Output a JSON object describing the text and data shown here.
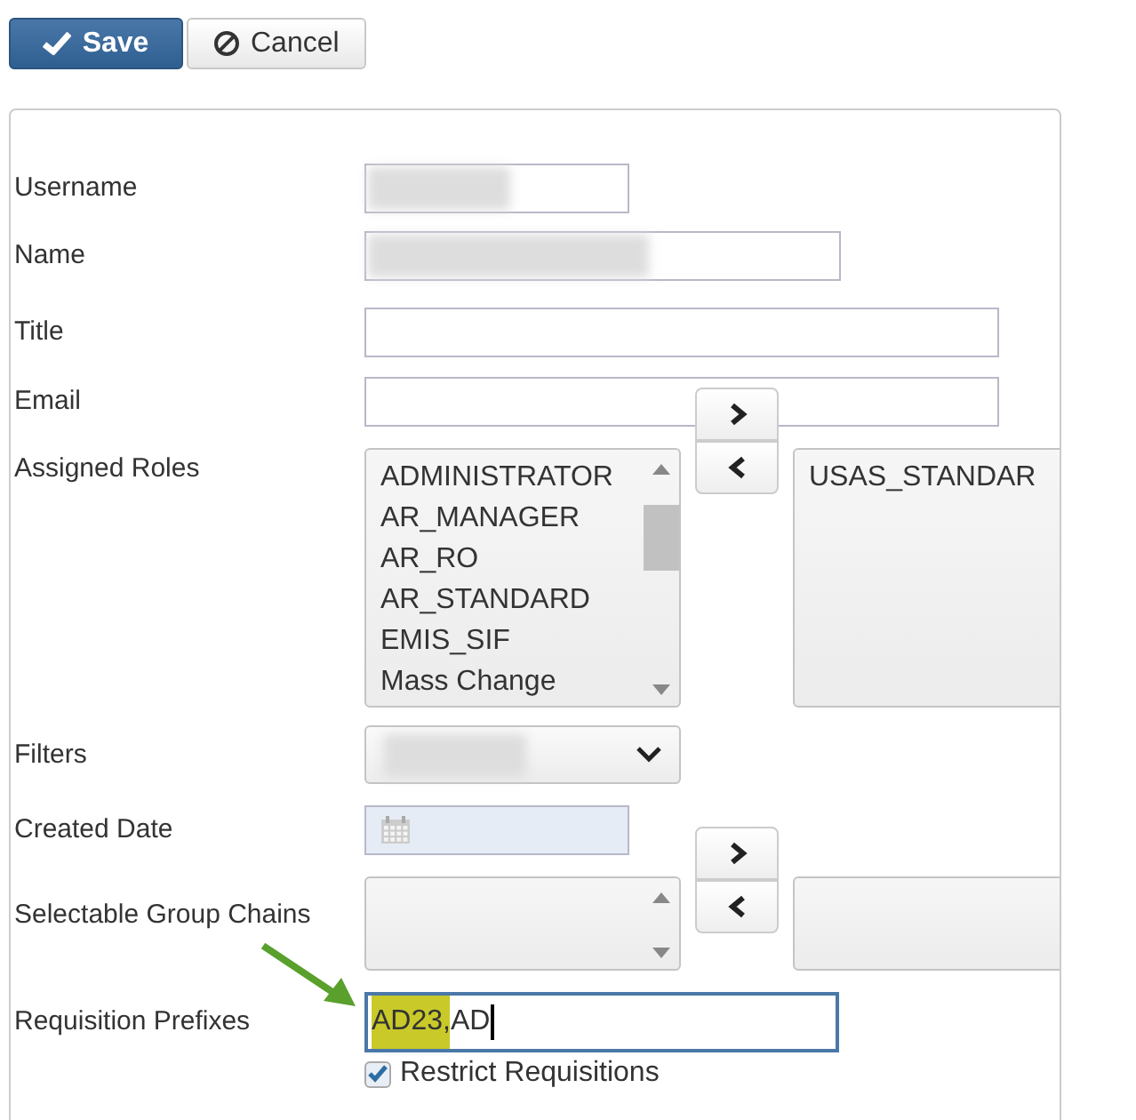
{
  "toolbar": {
    "save": {
      "label": "Save"
    },
    "cancel": {
      "label": "Cancel"
    }
  },
  "form": {
    "username": {
      "label": "Username"
    },
    "name": {
      "label": "Name"
    },
    "title": {
      "label": "Title"
    },
    "email": {
      "label": "Email"
    },
    "assigned_roles": {
      "label": "Assigned Roles",
      "available": [
        "ADMINISTRATOR",
        "AR_MANAGER",
        "AR_RO",
        "AR_STANDARD",
        "EMIS_SIF",
        "Mass Change"
      ],
      "assigned": [
        "USAS_STANDAR"
      ]
    },
    "filters": {
      "label": "Filters"
    },
    "created_date": {
      "label": "Created Date"
    },
    "group_chains": {
      "label": "Selectable Group Chains"
    },
    "requisition_prefixes": {
      "label": "Requisition Prefixes",
      "value_parts": [
        {
          "text": "AD23,",
          "highlighted": true
        },
        {
          "text": "AD",
          "highlighted": false
        }
      ],
      "annotated": true
    },
    "restrict_requisitions": {
      "label": "Restrict Requisitions",
      "checked": true
    }
  }
}
